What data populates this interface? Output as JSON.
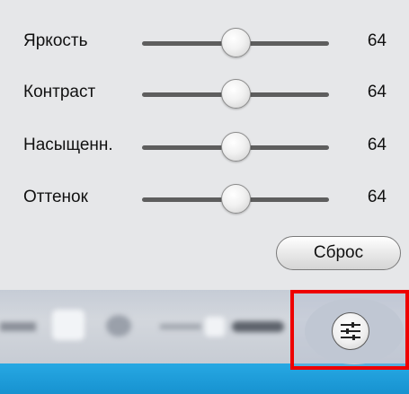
{
  "sliders": [
    {
      "label": "Яркость",
      "value": "64",
      "level": 0.5
    },
    {
      "label": "Контраст",
      "value": "64",
      "level": 0.5
    },
    {
      "label": "Насыщенн.",
      "value": "64",
      "level": 0.5
    },
    {
      "label": "Оттенок",
      "value": "64",
      "level": 0.5
    }
  ],
  "reset_label": "Сброс",
  "icons": {
    "settings": "sliders-adjust-icon"
  },
  "colors": {
    "highlight": "#ee0000",
    "accent_strip": "#1e9fdc",
    "panel_bg": "#e6e7e9"
  }
}
